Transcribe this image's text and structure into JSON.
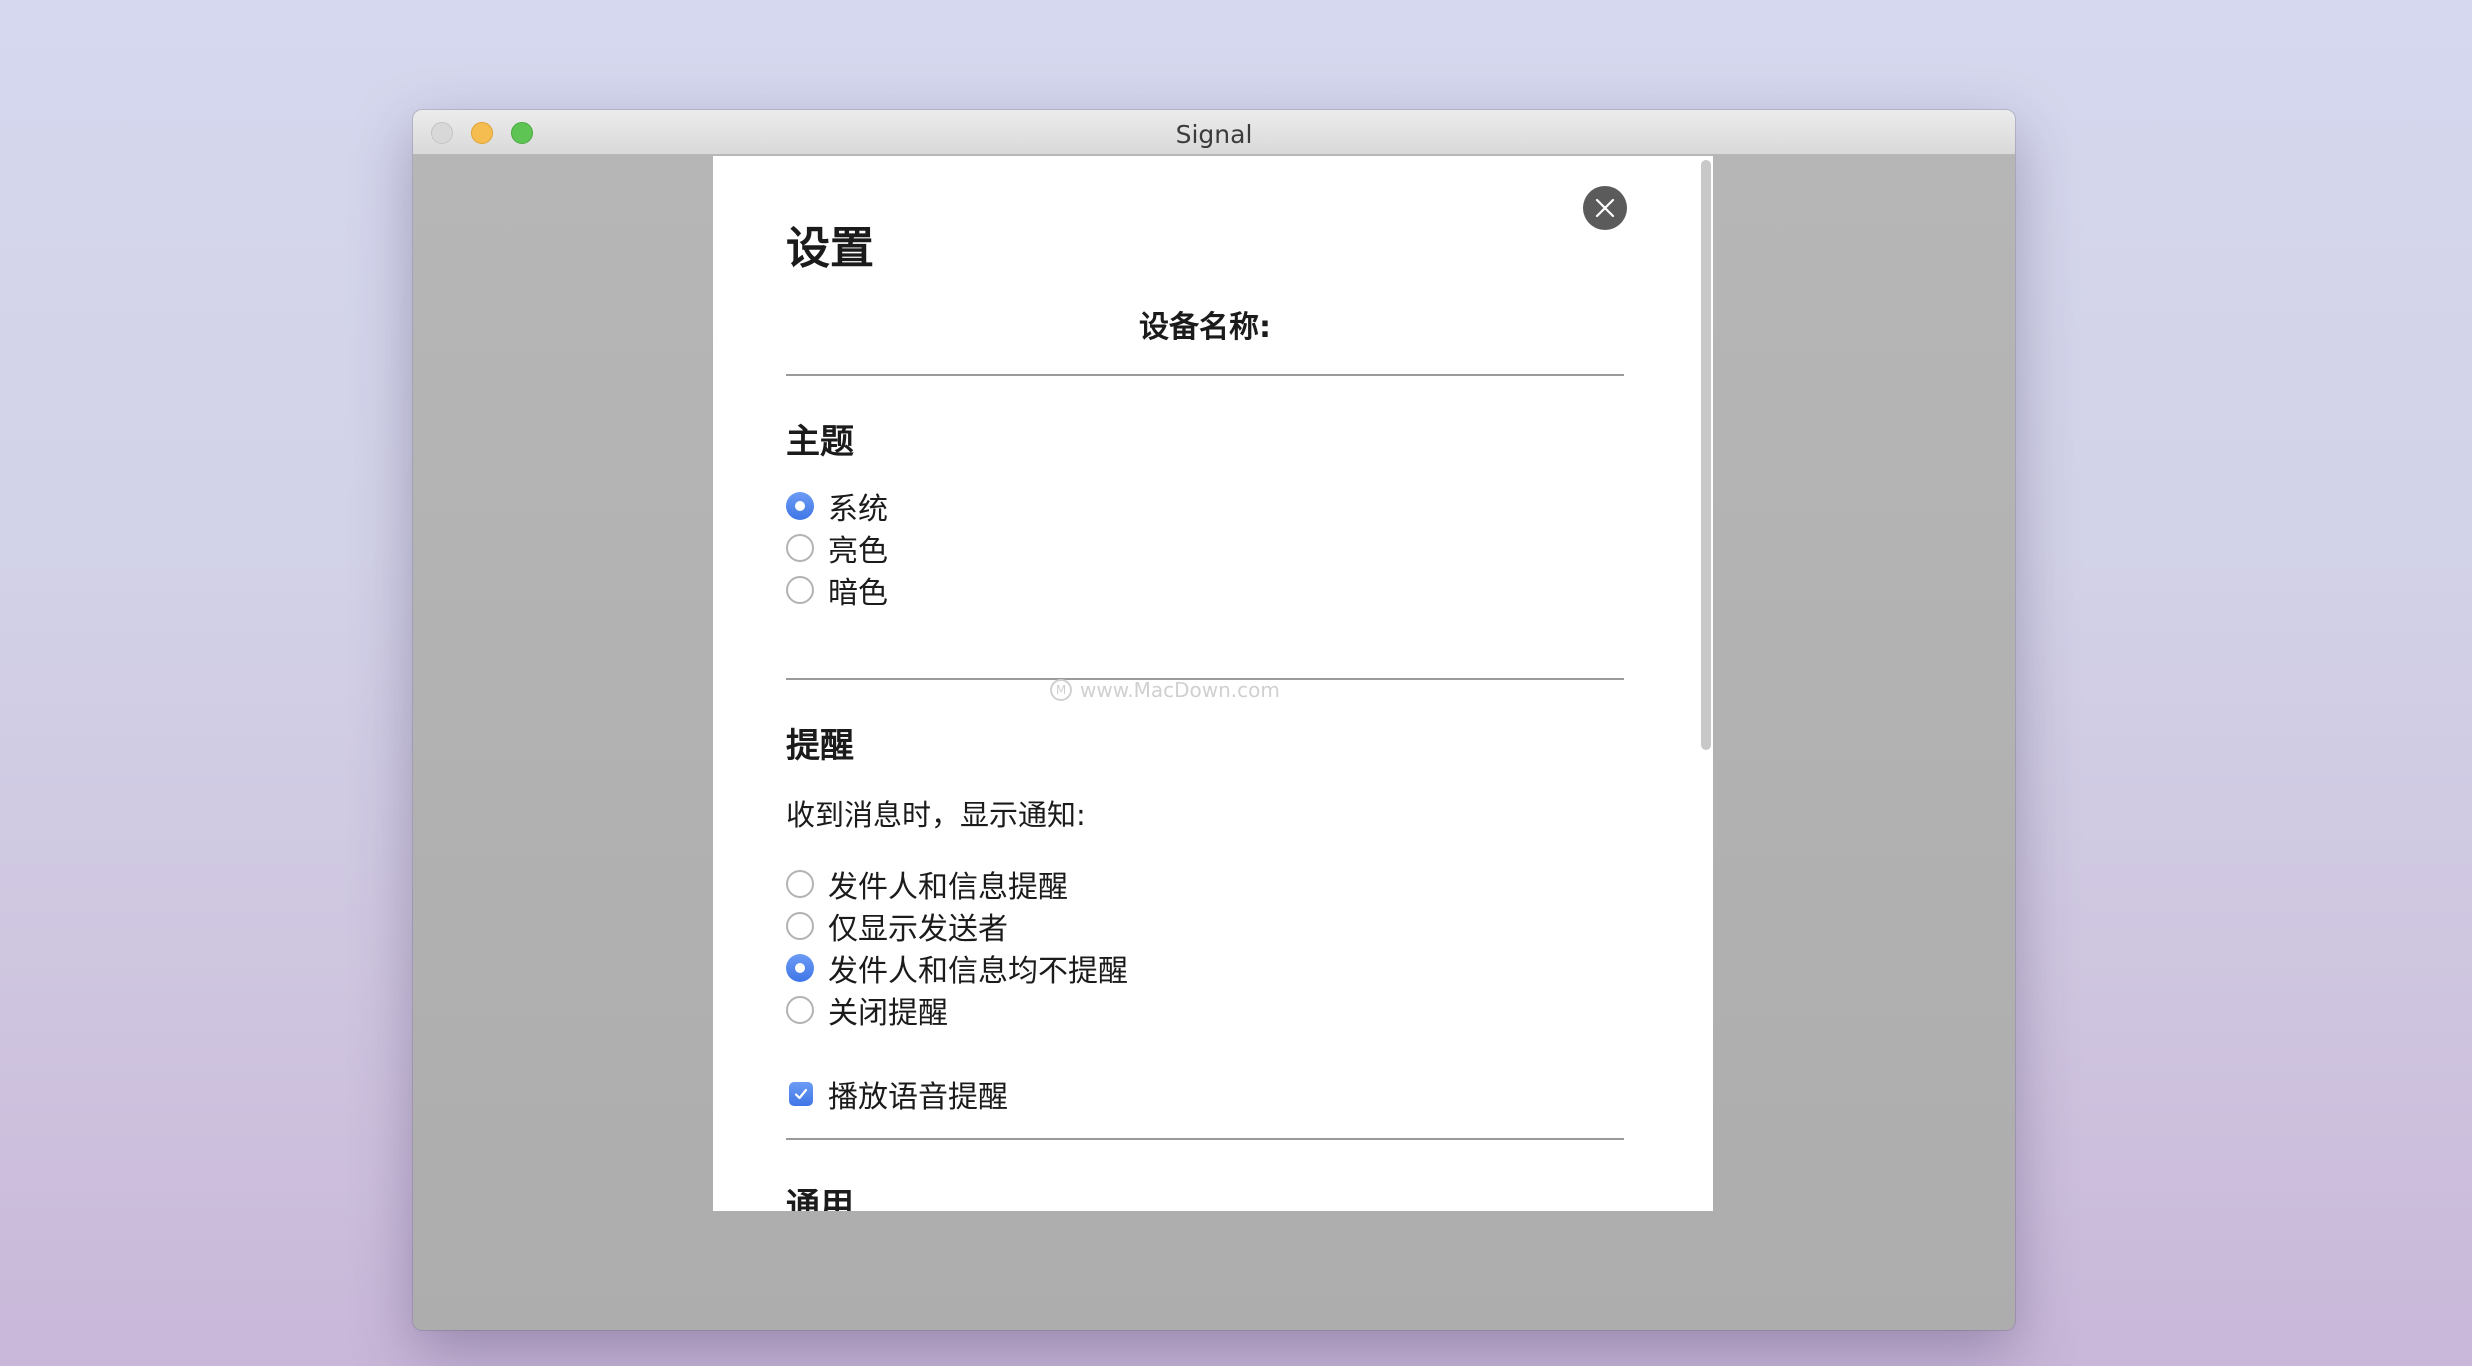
{
  "window": {
    "title": "Signal"
  },
  "settings": {
    "title": "设置",
    "device_name_label": "设备名称:",
    "theme": {
      "heading": "主题",
      "options": [
        {
          "label": "系统",
          "selected": true
        },
        {
          "label": "亮色",
          "selected": false
        },
        {
          "label": "暗色",
          "selected": false
        }
      ]
    },
    "notifications": {
      "heading": "提醒",
      "description": "收到消息时，显示通知:",
      "options": [
        {
          "label": "发件人和信息提醒",
          "selected": false
        },
        {
          "label": "仅显示发送者",
          "selected": false
        },
        {
          "label": "发件人和信息均不提醒",
          "selected": true
        },
        {
          "label": "关闭提醒",
          "selected": false
        }
      ],
      "audio_label": "播放语音提醒",
      "audio_checked": true
    },
    "general": {
      "heading": "通用"
    }
  },
  "watermark": {
    "text": "www.MacDown.com"
  },
  "colors": {
    "accent": "#3f76e6",
    "close_button": "#5b5b5b"
  }
}
